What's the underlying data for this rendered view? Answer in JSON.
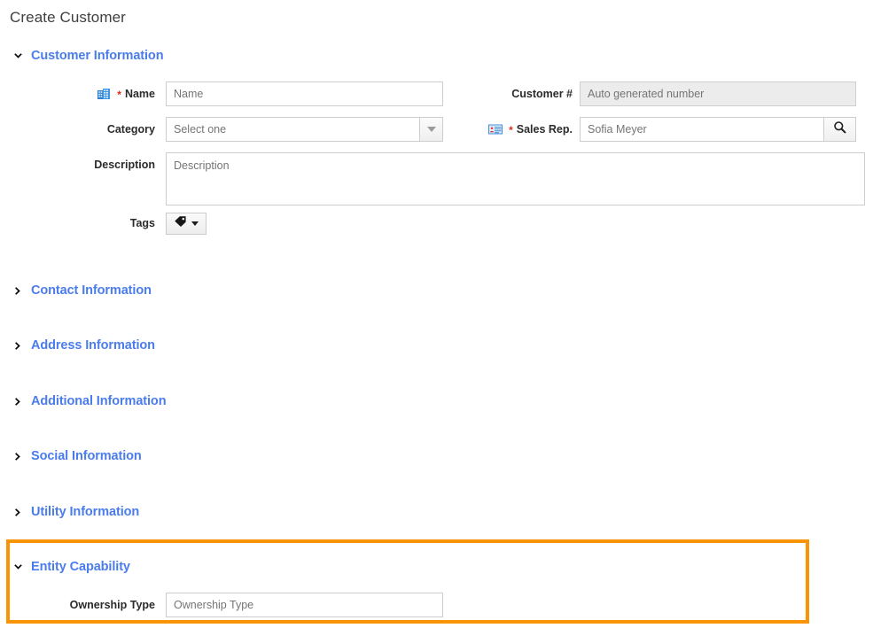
{
  "page": {
    "title": "Create Customer"
  },
  "colors": {
    "section_heading": "#4a7ceb",
    "highlight_border": "#f99406",
    "required_star": "#e02a1e",
    "placeholder": "#8d8d8d"
  },
  "sections": [
    {
      "id": "customer-information",
      "label": "Customer Information",
      "expanded": true,
      "chevron": "chevron-down-icon"
    },
    {
      "id": "contact-information",
      "label": "Contact Information",
      "expanded": false,
      "chevron": "chevron-right-icon"
    },
    {
      "id": "address-information",
      "label": "Address Information",
      "expanded": false,
      "chevron": "chevron-right-icon"
    },
    {
      "id": "additional-information",
      "label": "Additional Information",
      "expanded": false,
      "chevron": "chevron-right-icon"
    },
    {
      "id": "social-information",
      "label": "Social Information",
      "expanded": false,
      "chevron": "chevron-right-icon"
    },
    {
      "id": "utility-information",
      "label": "Utility Information",
      "expanded": false,
      "chevron": "chevron-right-icon"
    },
    {
      "id": "entity-capability",
      "label": "Entity Capability",
      "expanded": true,
      "chevron": "chevron-down-icon",
      "highlighted": true
    }
  ],
  "customer_information": {
    "name": {
      "label": "Name",
      "required": true,
      "required_mark": "*",
      "placeholder": "Name",
      "value": "",
      "icon": "building-icon"
    },
    "category": {
      "label": "Category",
      "required": false,
      "placeholder": "Select one",
      "value": "",
      "dropdown_icon": "caret-down-icon"
    },
    "description": {
      "label": "Description",
      "required": false,
      "placeholder": "Description",
      "value": ""
    },
    "tags": {
      "label": "Tags",
      "button_icon": "tag-icon",
      "caret_icon": "caret-down-icon"
    },
    "customer_number": {
      "label": "Customer #",
      "required": false,
      "placeholder": "Auto generated number",
      "value": "",
      "disabled": true
    },
    "sales_rep": {
      "label": "Sales Rep.",
      "required": true,
      "required_mark": "*",
      "placeholder": "Sofia Meyer",
      "value": "",
      "icon": "contact-card-icon",
      "search_icon": "search-icon"
    }
  },
  "entity_capability": {
    "ownership_type": {
      "label": "Ownership Type",
      "required": false,
      "placeholder": "Ownership Type",
      "value": ""
    }
  }
}
